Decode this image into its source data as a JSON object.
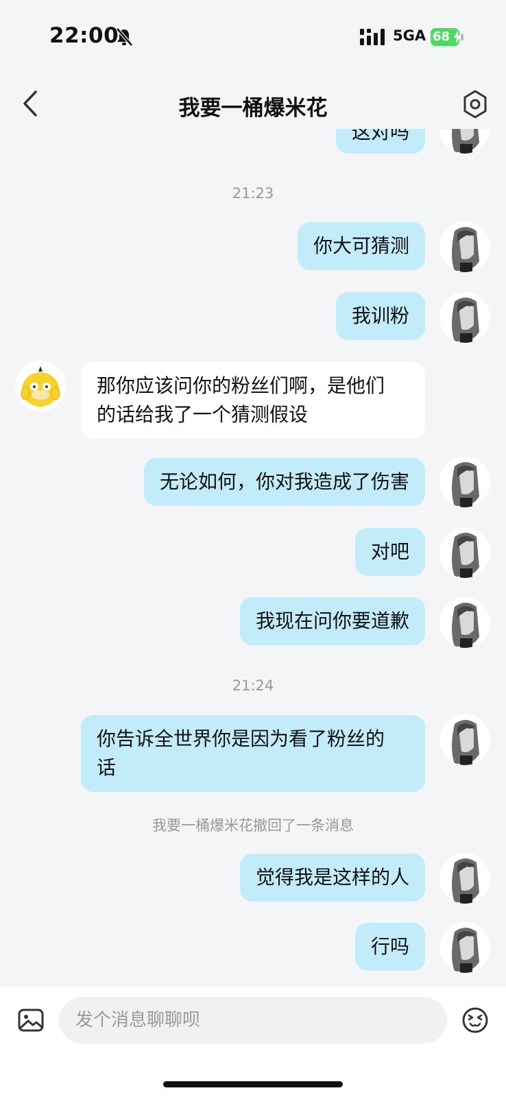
{
  "status_bar": {
    "time": "22:00",
    "network": "5GA",
    "battery": "68"
  },
  "nav": {
    "title": "我要一桶爆米花"
  },
  "messages": [
    {
      "type": "bubble",
      "sender": "me",
      "text": "这对吗"
    },
    {
      "type": "time",
      "text": "21:23"
    },
    {
      "type": "bubble",
      "sender": "me",
      "text": "你大可猜测"
    },
    {
      "type": "bubble",
      "sender": "me",
      "text": "我训粉"
    },
    {
      "type": "bubble",
      "sender": "other",
      "text": "那你应该问你的粉丝们啊，是他们\n的话给我了一个猜测假设"
    },
    {
      "type": "bubble",
      "sender": "me",
      "text": "无论如何，你对我造成了伤害"
    },
    {
      "type": "bubble",
      "sender": "me",
      "text": "对吧"
    },
    {
      "type": "bubble",
      "sender": "me",
      "text": "我现在问你要道歉"
    },
    {
      "type": "time",
      "text": "21:24"
    },
    {
      "type": "bubble",
      "sender": "me",
      "text": "你告诉全世界你是因为看了粉丝的\n话"
    },
    {
      "type": "notice",
      "text": "我要一桶爆米花撤回了一条消息"
    },
    {
      "type": "bubble",
      "sender": "me",
      "text": "觉得我是这样的人"
    },
    {
      "type": "bubble",
      "sender": "me",
      "text": "行吗"
    }
  ],
  "input": {
    "placeholder": "发个消息聊聊呗"
  },
  "colors": {
    "my_bubble": "#c3ecfb",
    "other_bubble": "#ffffff",
    "background": "#f4f5f7",
    "battery": "#4cd964"
  },
  "icons": {
    "back": "chevron-left-icon",
    "settings": "settings-icon",
    "image": "image-icon",
    "emoji": "emoji-icon",
    "mute": "bell-slash-icon"
  }
}
